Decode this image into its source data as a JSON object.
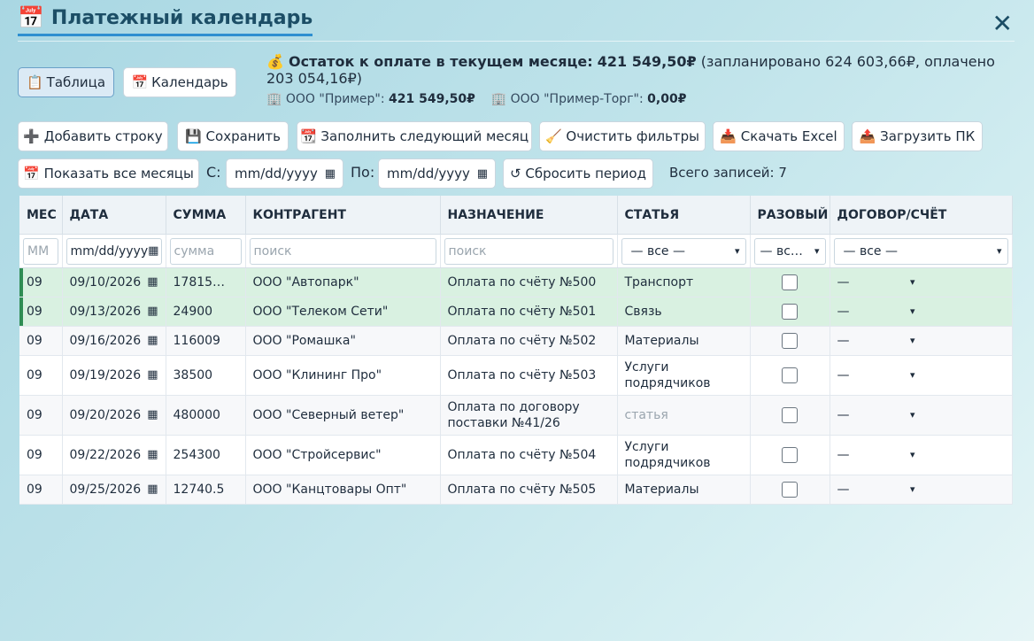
{
  "title": "Платежный календарь",
  "view_tabs": [
    {
      "icon": "📋",
      "label": "Таблица",
      "active": true
    },
    {
      "icon": "📅",
      "label": "Календарь",
      "active": false
    }
  ],
  "summary": {
    "icon": "💰",
    "prefix": "Остаток к оплате в текущем месяце:",
    "amount": "421 549,50₽",
    "detail": "(запланировано 624 603,66₽, оплачено 203 054,16₽)"
  },
  "orgs": [
    {
      "icon": "🏢",
      "name": "ООО \"Пример\":",
      "amount": "421 549,50₽"
    },
    {
      "icon": "🏢",
      "name": "ООО \"Пример-Торг\":",
      "amount": "0,00₽"
    }
  ],
  "toolbar": {
    "add_row": "➕ Добавить строку",
    "save": "💾 Сохранить",
    "fill_next": "📆 Заполнить следующий месяц",
    "clear_filters": "🧹 Очистить фильтры",
    "download_excel": "📥 Скачать Excel",
    "upload_pk": "📤 Загрузить ПК",
    "show_all_months": "📅 Показать все месяцы",
    "from_label": "С:",
    "to_label": "По:",
    "date_placeholder": "mm/dd/yyyy",
    "reset_period": "↺ Сбросить период",
    "total_records": "Всего записей: 7"
  },
  "columns": [
    "МЕС",
    "ДАТА",
    "СУММА",
    "КОНТРАГЕНТ",
    "НАЗНАЧЕНИЕ",
    "СТАТЬЯ",
    "РАЗОВЫЙ",
    "ДОГОВОР/СЧЁТ"
  ],
  "filters": {
    "month": "ММ",
    "date": "mm/dd/yyyy",
    "sum": "сумма",
    "contractor": "поиск",
    "purpose": "поиск",
    "article": "— все —",
    "oneoff": "— вс…",
    "contract": "— все —"
  },
  "rows": [
    {
      "month": "09",
      "date": "09/10/2026",
      "sum": "17815…",
      "contractor": "ООО \"Автопарк\"",
      "purpose": "Оплата по счёту №500",
      "article": "Транспорт",
      "contract": "—",
      "style": "green"
    },
    {
      "month": "09",
      "date": "09/13/2026",
      "sum": "24900",
      "contractor": "ООО \"Телеком Сети\"",
      "purpose": "Оплата по счёту №501",
      "article": "Связь",
      "contract": "—",
      "style": "green"
    },
    {
      "month": "09",
      "date": "09/16/2026",
      "sum": "116009",
      "contractor": "ООО \"Ромашка\"",
      "purpose": "Оплата по счёту №502",
      "article": "Материалы",
      "contract": "—",
      "style": "plain"
    },
    {
      "month": "09",
      "date": "09/19/2026",
      "sum": "38500",
      "contractor": "ООО \"Клининг Про\"",
      "purpose": "Оплата по счёту №503",
      "article": "Услуги подрядчиков",
      "contract": "—",
      "style": "alt"
    },
    {
      "month": "09",
      "date": "09/20/2026",
      "sum": "480000",
      "contractor": "ООО \"Северный ветер\"",
      "purpose": "Оплата по договору поставки №41/26",
      "article": "статья",
      "article_placeholder": true,
      "contract": "—",
      "style": "plain"
    },
    {
      "month": "09",
      "date": "09/22/2026",
      "sum": "254300",
      "contractor": "ООО \"Стройсервис\"",
      "purpose": "Оплата по счёту №504",
      "article": "Услуги подрядчиков",
      "contract": "—",
      "style": "alt"
    },
    {
      "month": "09",
      "date": "09/25/2026",
      "sum": "12740.5",
      "contractor": "ООО \"Канцтовары Опт\"",
      "purpose": "Оплата по счёту №505",
      "article": "Материалы",
      "contract": "—",
      "style": "plain"
    }
  ]
}
